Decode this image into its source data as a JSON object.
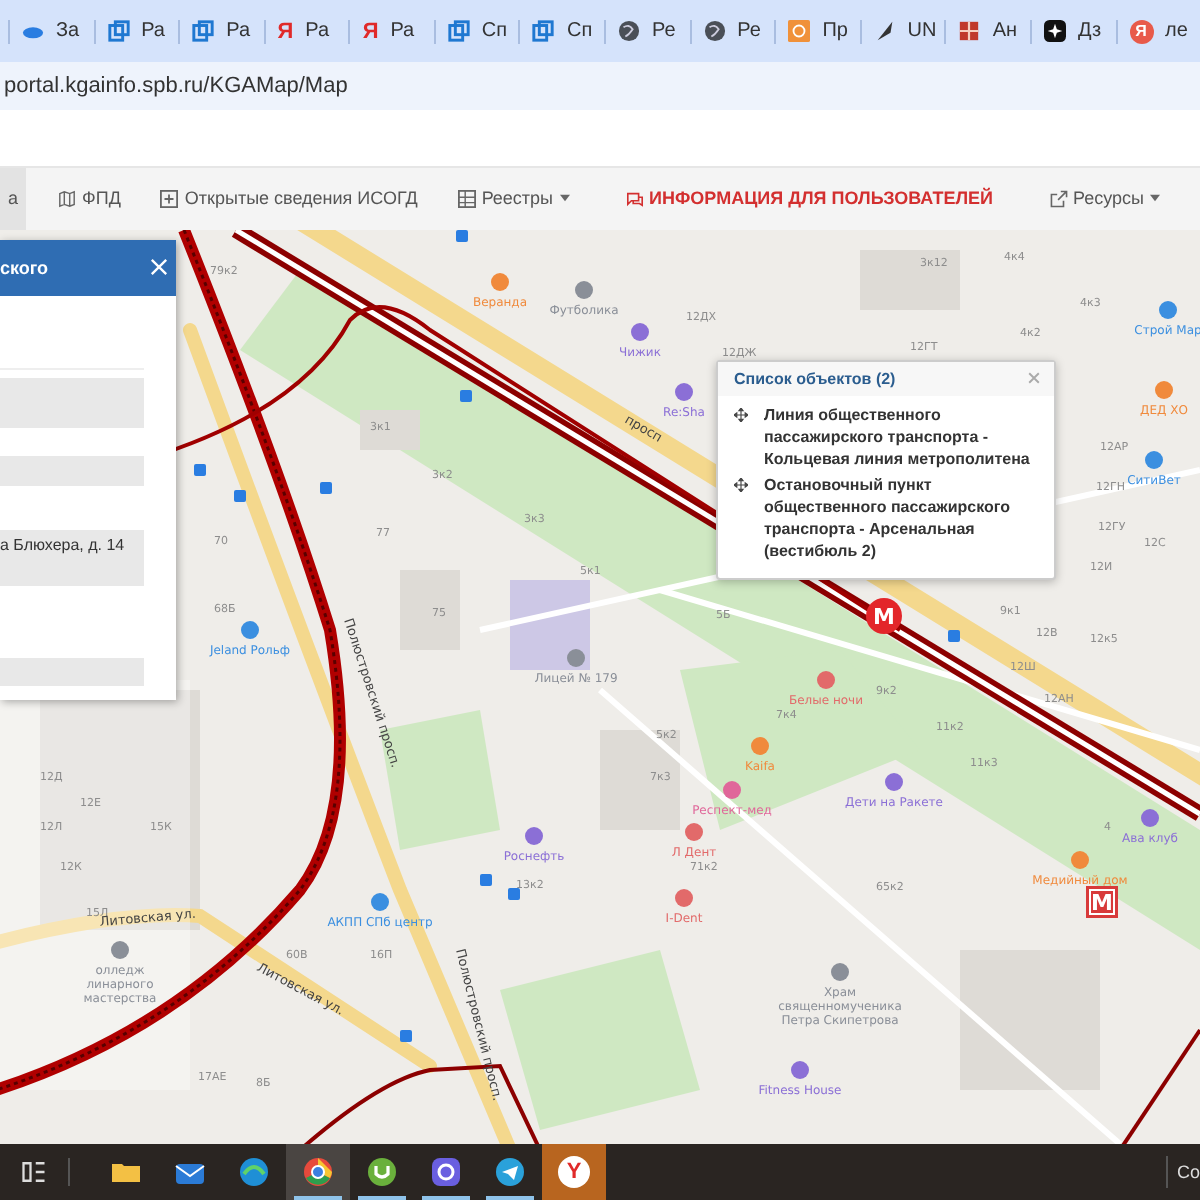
{
  "browser_tabs": [
    {
      "kind": "cloud",
      "label": "За"
    },
    {
      "kind": "window",
      "label": "Ра"
    },
    {
      "kind": "window",
      "label": "Ра"
    },
    {
      "kind": "letter",
      "glyph": "Я",
      "label": "Ра"
    },
    {
      "kind": "letter",
      "glyph": "Я",
      "label": "Ра"
    },
    {
      "kind": "window",
      "label": "Сп"
    },
    {
      "kind": "window",
      "label": "Сп"
    },
    {
      "kind": "globe",
      "label": "Ре"
    },
    {
      "kind": "globe",
      "label": "Ре"
    },
    {
      "kind": "orange",
      "label": "Пр"
    },
    {
      "kind": "feather",
      "label": "UN"
    },
    {
      "kind": "grid",
      "label": "Ан"
    },
    {
      "kind": "dark",
      "label": "Дз"
    },
    {
      "kind": "badge",
      "glyph": "Я",
      "label": "ле"
    }
  ],
  "address_bar": {
    "url": "portal.kgainfo.spb.ru/KGAMap/Map"
  },
  "nav": [
    {
      "label": "а",
      "selected": true,
      "alert": false,
      "dropdown": false
    },
    {
      "label": "ФПД",
      "selected": false,
      "alert": false,
      "dropdown": false
    },
    {
      "label": "Открытые сведения ИСОГД",
      "selected": false,
      "alert": false,
      "dropdown": false
    },
    {
      "label": "Реестры",
      "selected": false,
      "alert": false,
      "dropdown": true
    },
    {
      "label": "ИНФОРМАЦИЯ ДЛЯ ПОЛЬЗОВАТЕЛЕЙ",
      "selected": false,
      "alert": true,
      "dropdown": false
    },
    {
      "label": "Ресурсы",
      "selected": false,
      "alert": false,
      "dropdown": true
    }
  ],
  "side_panel": {
    "title": "ского",
    "address_value": "а Блюхера, д. 14"
  },
  "popup": {
    "title": "Список объектов (2)",
    "items": [
      "Линия общественного пассажирского транспорта - Кольцевая линия метрополитена",
      "Остановочный пункт общественного пассажирского транспорта - Арсенальная (вестибюль 2)"
    ]
  },
  "map": {
    "pois": [
      {
        "lines": [
          "Веранда"
        ],
        "color": "#f08a3c"
      },
      {
        "lines": [
          "Футболика"
        ],
        "color": "#8a8f98"
      },
      {
        "lines": [
          "Чижик"
        ],
        "color": "#8b6fd6"
      },
      {
        "lines": [
          "Re:Sha"
        ],
        "color": "#8b6fd6"
      },
      {
        "lines": [
          "Строй Мар"
        ],
        "color": "#3b8fe0"
      },
      {
        "lines": [
          "ДЕД ХО"
        ],
        "color": "#f08a3c"
      },
      {
        "lines": [
          "СитиВет"
        ],
        "color": "#3b8fe0"
      },
      {
        "lines": [
          "Jeland Рольф"
        ],
        "color": "#3b8fe0"
      },
      {
        "lines": [
          "Лицей № 179"
        ],
        "color": "#8a8f98"
      },
      {
        "lines": [
          "Белые ночи"
        ],
        "color": "#e26a6a"
      },
      {
        "lines": [
          "Kaifa"
        ],
        "color": "#f08a3c"
      },
      {
        "lines": [
          "Респект-мед"
        ],
        "color": "#e0679a"
      },
      {
        "lines": [
          "Дети на Ракете"
        ],
        "color": "#8b6fd6"
      },
      {
        "lines": [
          "Л Дент"
        ],
        "color": "#e26a6a"
      },
      {
        "lines": [
          "I-Dent"
        ],
        "color": "#e26a6a"
      },
      {
        "lines": [
          "Ава клуб"
        ],
        "color": "#8b6fd6"
      },
      {
        "lines": [
          "Медийный дом"
        ],
        "color": "#f08a3c"
      },
      {
        "lines": [
          "Храм",
          "священномученика",
          "Петра Скипетрова"
        ],
        "color": "#8a8f98"
      },
      {
        "lines": [
          "Fitness House"
        ],
        "color": "#8b6fd6"
      },
      {
        "lines": [
          "Роснефть"
        ],
        "color": "#8b6fd6"
      },
      {
        "lines": [
          "АКПП СПб центр"
        ],
        "color": "#3b8fe0"
      },
      {
        "lines": [
          "олледж",
          "линарного",
          "мастерства"
        ],
        "color": "#8a8f98"
      }
    ],
    "streets": [
      "Литовская ул.",
      "Литовская ул.",
      "Полюстровский просп.",
      "Полюстровский просп.",
      "просп"
    ],
    "house_numbers": [
      "79к2",
      "3к1",
      "3к2",
      "3к3",
      "77",
      "70",
      "75",
      "68Б",
      "5к1",
      "12ДХ",
      "12ДЖ",
      "12ГТ",
      "3к12",
      "4к4",
      "4к2",
      "4к3",
      "12АР",
      "12ГН",
      "12ГУ",
      "12С",
      "12И",
      "12АН",
      "12В",
      "12к5",
      "12Ш",
      "5Б",
      "5к2",
      "9к1",
      "11к2",
      "9к2",
      "7к4",
      "7к3",
      "11к3",
      "4",
      "71к2",
      "65к2",
      "13к2",
      "15Л",
      "12К",
      "12Л",
      "12Е",
      "12Д",
      "15К",
      "60В",
      "16П",
      "17АЕ",
      "8Б"
    ],
    "metro_marks": [
      {
        "kind": "pin",
        "letter": "M"
      },
      {
        "kind": "square",
        "letter": "M"
      }
    ]
  },
  "taskbar": {
    "apps": [
      {
        "kind": "folder",
        "selected": false,
        "open": false
      },
      {
        "kind": "mail",
        "selected": false,
        "open": false
      },
      {
        "kind": "edge",
        "selected": false,
        "open": false
      },
      {
        "kind": "chrome",
        "selected": true,
        "open": true
      },
      {
        "kind": "torrent",
        "selected": false,
        "open": true
      },
      {
        "kind": "chat",
        "selected": false,
        "open": true
      },
      {
        "kind": "telegram",
        "selected": false,
        "open": true
      },
      {
        "kind": "yandex",
        "glyph": "Y",
        "selected": false,
        "open": false
      }
    ],
    "tray_text": "Co"
  }
}
